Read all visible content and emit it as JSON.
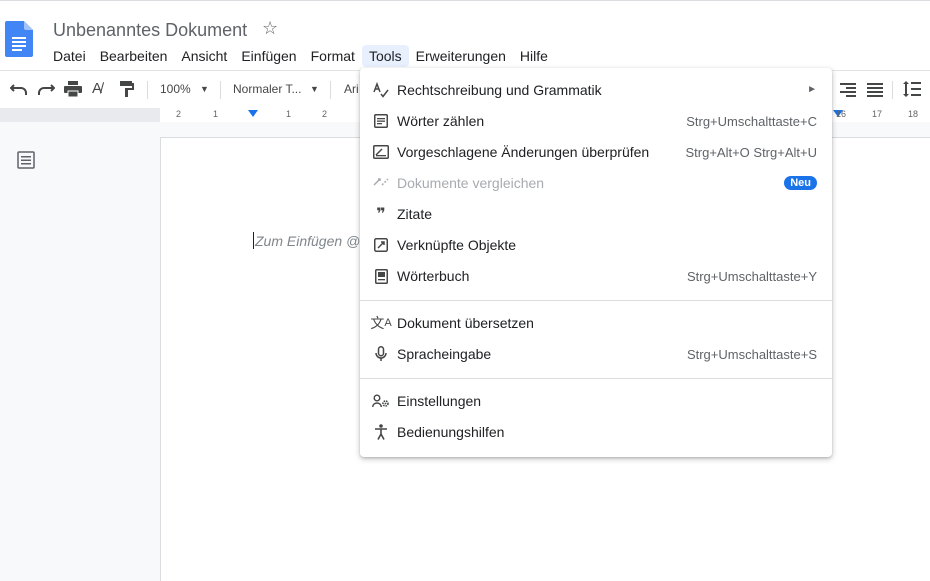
{
  "document": {
    "title": "Unbenanntes Dokument",
    "placeholder": "Zum Einfügen @"
  },
  "menubar": [
    "Datei",
    "Bearbeiten",
    "Ansicht",
    "Einfügen",
    "Format",
    "Tools",
    "Erweiterungen",
    "Hilfe"
  ],
  "toolbar": {
    "zoom": "100%",
    "style": "Normaler T...",
    "font": "Ari"
  },
  "ruler": {
    "left_numbers": [
      "2",
      "1",
      "1",
      "2"
    ],
    "right_numbers": [
      "16",
      "17",
      "18"
    ]
  },
  "tools_menu": {
    "items": [
      {
        "label": "Rechtschreibung und Grammatik",
        "shortcut": "",
        "icon": "spellcheck-icon",
        "submenu": true,
        "disabled": false,
        "badge": ""
      },
      {
        "label": "Wörter zählen",
        "shortcut": "Strg+Umschalttaste+C",
        "icon": "word-count-icon",
        "submenu": false,
        "disabled": false,
        "badge": ""
      },
      {
        "label": "Vorgeschlagene Änderungen überprüfen",
        "shortcut": "Strg+Alt+O Strg+Alt+U",
        "icon": "review-icon",
        "submenu": false,
        "disabled": false,
        "badge": ""
      },
      {
        "label": "Dokumente vergleichen",
        "shortcut": "",
        "icon": "compare-icon",
        "submenu": false,
        "disabled": true,
        "badge": "Neu"
      },
      {
        "label": "Zitate",
        "shortcut": "",
        "icon": "quote-icon",
        "submenu": false,
        "disabled": false,
        "badge": ""
      },
      {
        "label": "Verknüpfte Objekte",
        "shortcut": "",
        "icon": "linked-objects-icon",
        "submenu": false,
        "disabled": false,
        "badge": ""
      },
      {
        "label": "Wörterbuch",
        "shortcut": "Strg+Umschalttaste+Y",
        "icon": "dictionary-icon",
        "submenu": false,
        "disabled": false,
        "badge": ""
      },
      {
        "label": "Dokument übersetzen",
        "shortcut": "",
        "icon": "translate-icon",
        "submenu": false,
        "disabled": false,
        "badge": ""
      },
      {
        "label": "Spracheingabe",
        "shortcut": "Strg+Umschalttaste+S",
        "icon": "microphone-icon",
        "submenu": false,
        "disabled": false,
        "badge": ""
      },
      {
        "label": "Einstellungen",
        "shortcut": "",
        "icon": "preferences-icon",
        "submenu": false,
        "disabled": false,
        "badge": ""
      },
      {
        "label": "Bedienungshilfen",
        "shortcut": "",
        "icon": "accessibility-icon",
        "submenu": false,
        "disabled": false,
        "badge": ""
      }
    ]
  },
  "colors": {
    "accent": "#1a73e8",
    "docs_blue": "#4285f4"
  }
}
